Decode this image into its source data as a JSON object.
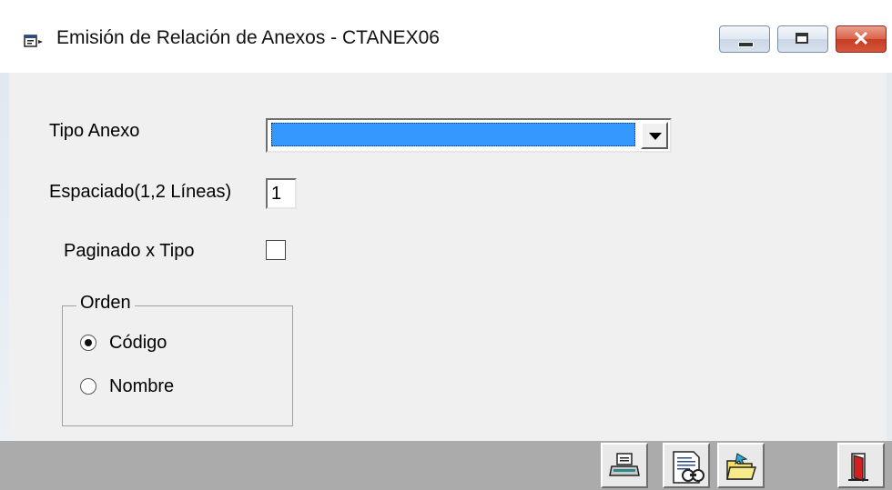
{
  "window": {
    "title": "Emisión de Relación de Anexos - CTANEX06",
    "controls": [
      "minimize",
      "maximize",
      "close"
    ]
  },
  "form": {
    "tipo_anexo": {
      "label": "Tipo Anexo",
      "value": ""
    },
    "espaciado": {
      "label": "Espaciado(1,2 Líneas)",
      "value": "1"
    },
    "paginado": {
      "label": "Paginado x Tipo",
      "checked": false
    },
    "orden": {
      "title": "Orden",
      "options": [
        {
          "label": "Código",
          "selected": true
        },
        {
          "label": "Nombre",
          "selected": false
        }
      ]
    }
  },
  "toolbar": {
    "buttons": [
      {
        "icon": "printer-icon"
      },
      {
        "icon": "print-preview-icon"
      },
      {
        "icon": "open-folder-icon"
      },
      {
        "icon": "exit-door-icon"
      }
    ]
  },
  "colors": {
    "selection": "#3399ff",
    "toolbar_bg": "#ababab",
    "close_button": "#c53b22"
  }
}
